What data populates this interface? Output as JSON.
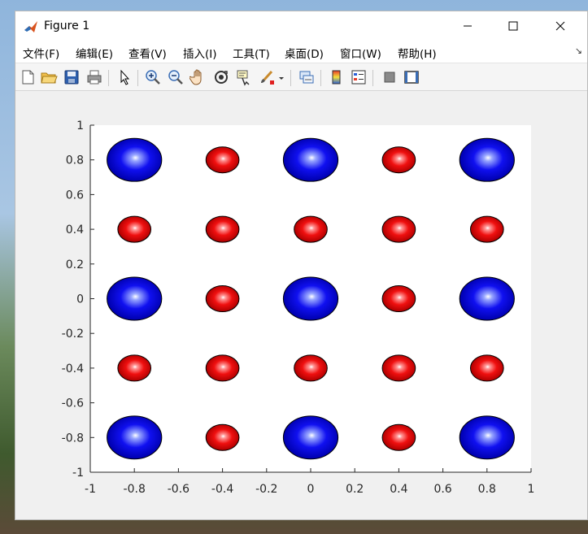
{
  "window": {
    "title": "Figure 1"
  },
  "menu": {
    "items": [
      "文件(F)",
      "编辑(E)",
      "查看(V)",
      "插入(I)",
      "工具(T)",
      "桌面(D)",
      "窗口(W)",
      "帮助(H)"
    ]
  },
  "toolbar": {
    "tools": [
      "new-figure-icon",
      "open-file-icon",
      "save-icon",
      "print-icon",
      "pointer-icon",
      "zoom-in-icon",
      "zoom-out-icon",
      "pan-hand-icon",
      "rotate-3d-icon",
      "data-cursor-icon",
      "brush-icon",
      "link-plot-icon",
      "colorbar-icon",
      "legend-icon",
      "hide-plot-tools-icon",
      "show-plot-tools-icon"
    ]
  },
  "chart_data": {
    "type": "scatter",
    "xlim": [
      -1,
      1
    ],
    "ylim": [
      -1,
      1
    ],
    "x_ticks": [
      "-1",
      "-0.8",
      "-0.6",
      "-0.4",
      "-0.2",
      "0",
      "0.2",
      "0.4",
      "0.6",
      "0.8",
      "1"
    ],
    "y_ticks": [
      "1",
      "0.8",
      "0.6",
      "0.4",
      "0.2",
      "0",
      "-0.2",
      "-0.4",
      "-0.6",
      "-0.8",
      "-1"
    ],
    "grid": false,
    "series": [
      {
        "color": "#0000dd",
        "marker": "large-sphere",
        "points": [
          [
            -0.8,
            0.8
          ],
          [
            0,
            0.8
          ],
          [
            0.8,
            0.8
          ],
          [
            -0.8,
            0
          ],
          [
            0,
            0
          ],
          [
            0.8,
            0
          ],
          [
            -0.8,
            -0.8
          ],
          [
            0,
            -0.8
          ],
          [
            0.8,
            -0.8
          ]
        ]
      },
      {
        "color": "#dd0000",
        "marker": "small-sphere",
        "points": [
          [
            -0.4,
            0.8
          ],
          [
            0.4,
            0.8
          ],
          [
            -0.8,
            0.4
          ],
          [
            -0.4,
            0.4
          ],
          [
            0,
            0.4
          ],
          [
            0.4,
            0.4
          ],
          [
            0.8,
            0.4
          ],
          [
            -0.4,
            0
          ],
          [
            0.4,
            0
          ],
          [
            -0.8,
            -0.4
          ],
          [
            -0.4,
            -0.4
          ],
          [
            0,
            -0.4
          ],
          [
            0.4,
            -0.4
          ],
          [
            0.8,
            -0.4
          ],
          [
            -0.4,
            -0.8
          ],
          [
            0.4,
            -0.8
          ]
        ]
      }
    ]
  }
}
